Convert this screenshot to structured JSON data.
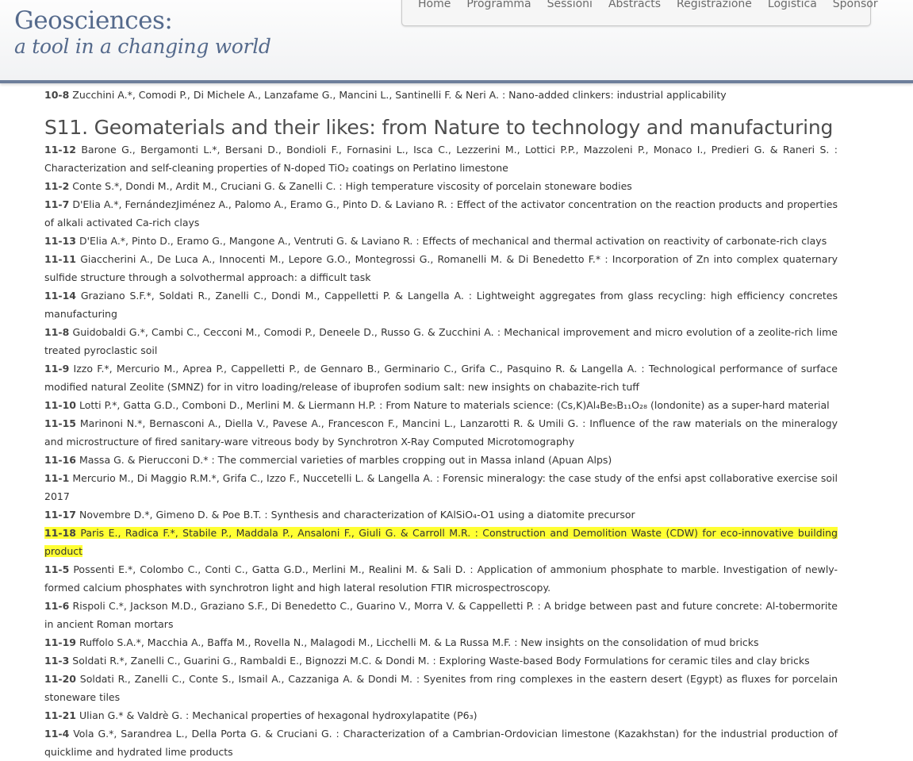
{
  "site": {
    "title": "Geosciences:",
    "subtitle": "a tool in a changing world"
  },
  "nav": {
    "items": [
      "Home",
      "Programma",
      "Sessioni",
      "Abstracts",
      "Registrazione",
      "Logistica",
      "Sponsor"
    ]
  },
  "content": {
    "prev_entry": {
      "num": "10-8",
      "text": "Zucchini A.*, Comodi P., Di Michele A., Lanzafame G., Mancini L., Santinelli F. & Neri A. : Nano-added clinkers: industrial applicability"
    },
    "section_title": "S11. Geomaterials and their likes: from Nature to technology and manufacturing",
    "entries": [
      {
        "num": "11-12",
        "text": "Barone G., Bergamonti L.*, Bersani D., Bondioli F., Fornasini L., Isca C., Lezzerini M., Lottici P.P., Mazzoleni P., Monaco I., Predieri G. & Raneri S. : Characterization and self-cleaning properties of N-doped TiO₂ coatings on Perlatino limestone"
      },
      {
        "num": "11-2",
        "text": "Conte S.*, Dondi M., Ardit M., Cruciani G. & Zanelli C. : High temperature viscosity of porcelain stoneware bodies"
      },
      {
        "num": "11-7",
        "text": "D'Elia A.*, FernándezJiménez A., Palomo A., Eramo G., Pinto D. & Laviano R. : Effect of the activator concentration on the reaction products and properties of alkali activated Ca-rich clays"
      },
      {
        "num": "11-13",
        "text": "D'Elia A.*, Pinto D., Eramo G., Mangone A., Ventruti G. & Laviano R. : Effects of mechanical and thermal activation on reactivity of carbonate-rich clays"
      },
      {
        "num": "11-11",
        "text": "Giaccherini A., De Luca A., Innocenti M., Lepore G.O., Montegrossi G., Romanelli M. & Di Benedetto F.* : Incorporation of Zn into complex quaternary sulfide structure through a solvothermal approach: a difficult task"
      },
      {
        "num": "11-14",
        "text": "Graziano S.F.*, Soldati R., Zanelli C., Dondi M., Cappelletti P. & Langella A. : Lightweight aggregates from glass recycling: high efficiency concretes manufacturing"
      },
      {
        "num": "11-8",
        "text": "Guidobaldi G.*, Cambi C., Cecconi M., Comodi P., Deneele D., Russo G. & Zucchini A. : Mechanical improvement and micro evolution of a zeolite-rich lime treated pyroclastic soil"
      },
      {
        "num": "11-9",
        "text": "Izzo F.*, Mercurio M., Aprea P., Cappelletti P., de Gennaro B., Germinario C., Grifa C., Pasquino R. & Langella A. : Technological performance of surface modified natural Zeolite (SMNZ) for in vitro loading/release of ibuprofen sodium salt: new insights on chabazite-rich tuff"
      },
      {
        "num": "11-10",
        "text": "Lotti P.*, Gatta G.D., Comboni D., Merlini M. & Liermann H.P. : From Nature to materials science: (Cs,K)Al₄Be₅B₁₁O₂₈ (londonite) as a super-hard material"
      },
      {
        "num": "11-15",
        "text": "Marinoni N.*, Bernasconi A., Diella V., Pavese A., Francescon F., Mancini L., Lanzarotti R. & Umili G. : Influence of the raw materials on the mineralogy and microstructure of fired sanitary-ware vitreous body by Synchrotron X-Ray Computed Microtomography"
      },
      {
        "num": "11-16",
        "text": "Massa G. & Pierucconi D.* : The commercial varieties of marbles cropping out in Massa inland (Apuan Alps)"
      },
      {
        "num": "11-1",
        "text": "Mercurio M., Di Maggio R.M.*, Grifa C., Izzo F., Nuccetelli L. & Langella A. : Forensic mineralogy: the case study of the enfsi apst collaborative exercise soil 2017"
      },
      {
        "num": "11-17",
        "text": "Novembre D.*, Gimeno D. & Poe B.T. : Synthesis and characterization of KAlSiO₄-O1 using a diatomite precursor"
      },
      {
        "num": "11-18",
        "text": "Paris E., Radica F.*, Stabile P., Maddala P., Ansaloni F., Giuli G. & Carroll M.R. : Construction and Demolition Waste (CDW) for eco-innovative building product",
        "highlight": true
      },
      {
        "num": "11-5",
        "text": "Possenti E.*, Colombo C., Conti C., Gatta G.D., Merlini M., Realini M. & Sali D. : Application of ammonium phosphate to marble. Investigation of newly-formed calcium phosphates with synchrotron light and high lateral resolution FTIR microspectroscopy."
      },
      {
        "num": "11-6",
        "text": "Rispoli C.*, Jackson M.D., Graziano S.F., Di Benedetto C., Guarino V., Morra V. & Cappelletti P. : A bridge between past and future concrete: Al-tobermorite in ancient Roman mortars"
      },
      {
        "num": "11-19",
        "text": "Ruffolo S.A.*, Macchia A., Baffa M., Rovella N., Malagodi M., Licchelli M. & La Russa M.F. : New insights on the consolidation of mud bricks"
      },
      {
        "num": "11-3",
        "text": "Soldati R.*, Zanelli C., Guarini G., Rambaldi E., Bignozzi M.C. & Dondi M. : Exploring Waste-based Body Formulations for ceramic tiles and clay bricks"
      },
      {
        "num": "11-20",
        "text": "Soldati R., Zanelli C., Conte S., Ismail A., Cazzaniga A. & Dondi M. : Syenites from ring complexes in the eastern desert (Egypt) as fluxes for porcelain stoneware tiles"
      },
      {
        "num": "11-21",
        "text": "Ulian G.* & Valdrè G. : Mechanical properties of hexagonal hydroxylapatite (P6₃)"
      },
      {
        "num": "11-4",
        "text": "Vola G.*, Sarandrea L., Della Porta G. & Cruciani G. : Characterization of a Cambrian-Ordovician limestone (Kazakhstan) for the industrial production of quicklime and hydrated lime products"
      }
    ]
  },
  "colors": {
    "brand": "#556a8c",
    "header_border": "#6d7e9b",
    "highlight": "#ffff33"
  }
}
